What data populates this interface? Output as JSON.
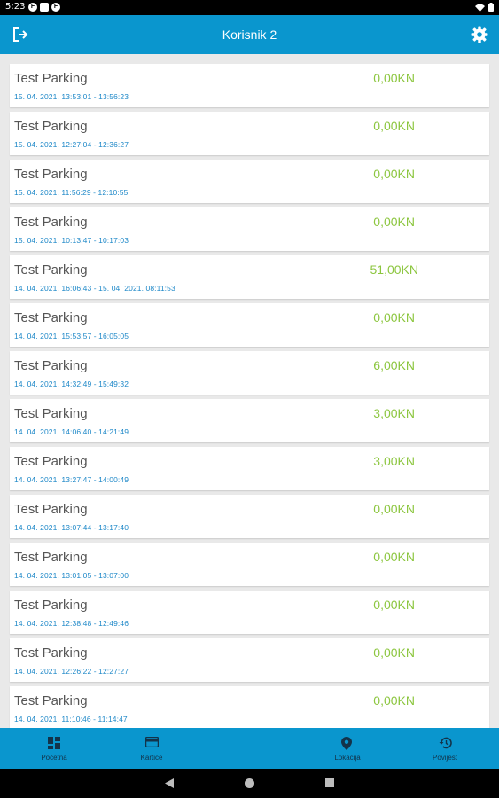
{
  "status_bar": {
    "time": "5:23"
  },
  "header": {
    "title": "Korisnik 2"
  },
  "sessions": [
    {
      "name": "Test Parking",
      "period": "15. 04. 2021. 13:53:01 - 13:56:23",
      "amount": "0,00KN"
    },
    {
      "name": "Test Parking",
      "period": "15. 04. 2021. 12:27:04 - 12:36:27",
      "amount": "0,00KN"
    },
    {
      "name": "Test Parking",
      "period": "15. 04. 2021. 11:56:29 - 12:10:55",
      "amount": "0,00KN"
    },
    {
      "name": "Test Parking",
      "period": "15. 04. 2021. 10:13:47 - 10:17:03",
      "amount": "0,00KN"
    },
    {
      "name": "Test Parking",
      "period": "14. 04. 2021. 16:06:43 - 15. 04. 2021. 08:11:53",
      "amount": "51,00KN"
    },
    {
      "name": "Test Parking",
      "period": "14. 04. 2021. 15:53:57 - 16:05:05",
      "amount": "0,00KN"
    },
    {
      "name": "Test Parking",
      "period": "14. 04. 2021. 14:32:49 - 15:49:32",
      "amount": "6,00KN"
    },
    {
      "name": "Test Parking",
      "period": "14. 04. 2021. 14:06:40 - 14:21:49",
      "amount": "3,00KN"
    },
    {
      "name": "Test Parking",
      "period": "14. 04. 2021. 13:27:47 - 14:00:49",
      "amount": "3,00KN"
    },
    {
      "name": "Test Parking",
      "period": "14. 04. 2021. 13:07:44 - 13:17:40",
      "amount": "0,00KN"
    },
    {
      "name": "Test Parking",
      "period": "14. 04. 2021. 13:01:05 - 13:07:00",
      "amount": "0,00KN"
    },
    {
      "name": "Test Parking",
      "period": "14. 04. 2021. 12:38:48 - 12:49:46",
      "amount": "0,00KN"
    },
    {
      "name": "Test Parking",
      "period": "14. 04. 2021. 12:26:22 - 12:27:27",
      "amount": "0,00KN"
    },
    {
      "name": "Test Parking",
      "period": "14. 04. 2021. 11:10:46 - 11:14:47",
      "amount": "0,00KN"
    }
  ],
  "bottom_nav": {
    "items": [
      {
        "label": "Početna",
        "icon": "dashboard-icon"
      },
      {
        "label": "Kartice",
        "icon": "card-icon"
      },
      {
        "label": "Lokacija",
        "icon": "location-pin-icon"
      },
      {
        "label": "Povijest",
        "icon": "history-icon"
      }
    ]
  },
  "colors": {
    "primary": "#0a96ce",
    "amount": "#8cc63f",
    "date": "#1e88c8"
  }
}
